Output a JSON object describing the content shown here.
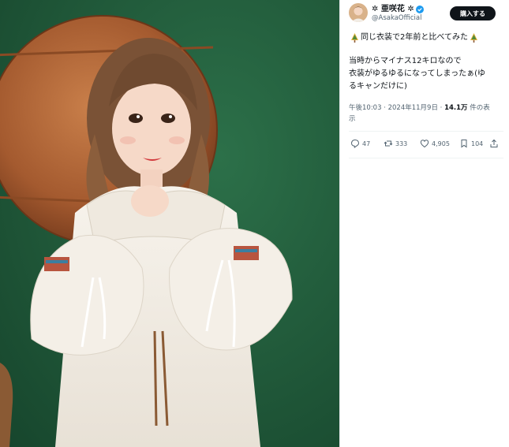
{
  "author": {
    "display_name": "✲ 亜咲花 ✲",
    "handle": "@AsakaOfficial",
    "verified": true
  },
  "buy_button": {
    "label": "購入する"
  },
  "tweet": {
    "text_line_1": "同じ衣装で2年前と比べてみた",
    "text_line_2": "当時からマイナス12キロなので",
    "text_line_3": "衣装がゆるゆるになってしまったぁ(ゆ",
    "text_line_4": "るキャンだけに)",
    "emoji_icon": "christmas-tree-icon"
  },
  "meta": {
    "time_date": "午後10:03 · 2024年11月9日 · ",
    "views": "14.1万",
    "views_suffix": " 件の表",
    "views_suffix_2": "示"
  },
  "actions": {
    "replies": "47",
    "reposts": "333",
    "likes": "4,905",
    "bookmarks": "104"
  },
  "colors": {
    "accent": "#1d9bf0",
    "text": "#0f1419",
    "muted": "#536471",
    "wall_green": "#1f5a3a"
  }
}
